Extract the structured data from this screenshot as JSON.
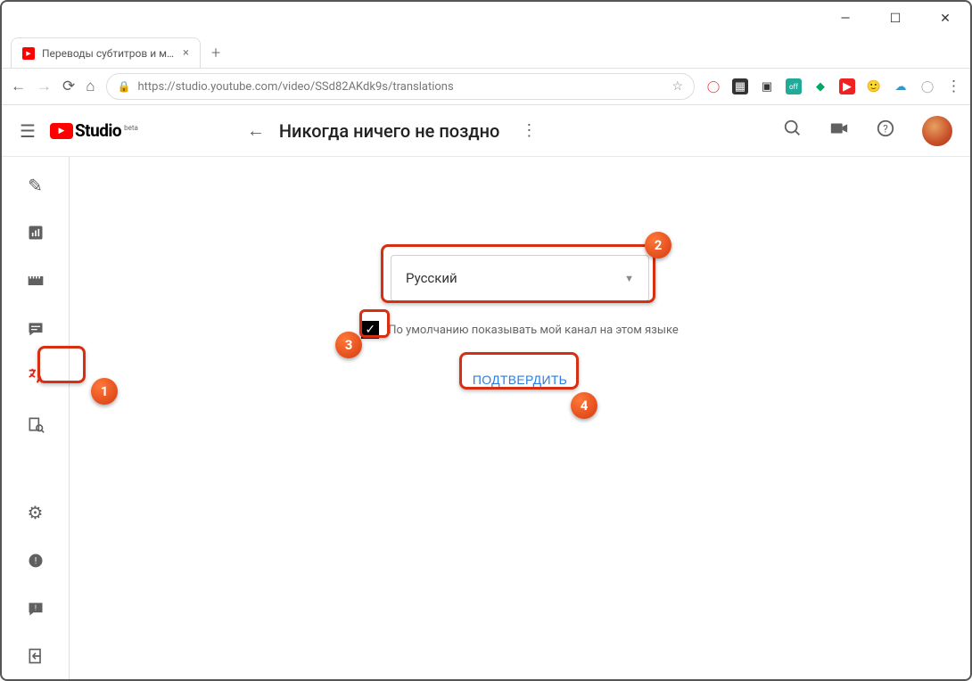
{
  "window": {
    "min": "—",
    "max": "☐",
    "close": "✕"
  },
  "tab": {
    "title": "Переводы субтитров и метадан…"
  },
  "url": "https://studio.youtube.com/video/SSd82AKdk9s/translations",
  "logo": {
    "text": "Studio",
    "beta": "beta"
  },
  "header": {
    "title": "Никогда ничего не поздно"
  },
  "dropdown": {
    "value": "Русский"
  },
  "checkbox": {
    "label": "По умолчанию показывать мой канал на этом языке",
    "checked": true
  },
  "confirm": "ПОДТВЕРДИТЬ",
  "annotations": {
    "1": "1",
    "2": "2",
    "3": "3",
    "4": "4"
  }
}
